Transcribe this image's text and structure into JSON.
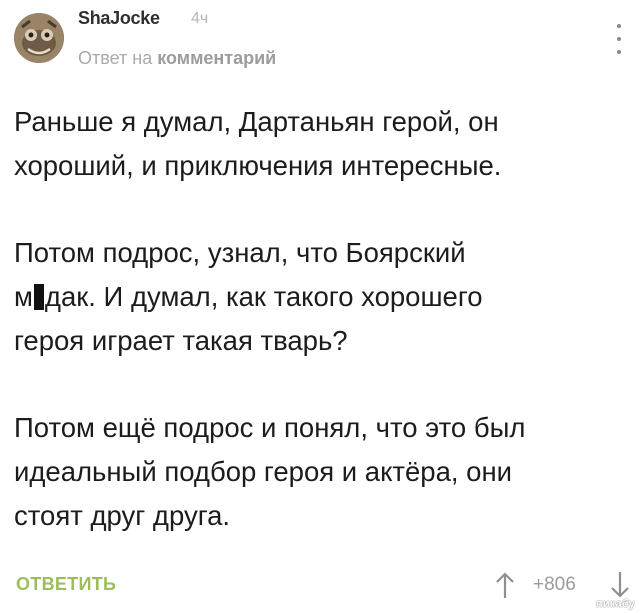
{
  "comment_header": {
    "username": "ShaJocke",
    "time": "4ч",
    "reply_prefix": "Ответ на",
    "reply_target": "комментарий",
    "avatar_icon": "user-avatar",
    "more_icon": "vertical-dots-icon"
  },
  "comment_body": {
    "paragraph_1": {
      "line_1": "Раньше я думал, Дартаньян герой, он",
      "line_2": "хороший, и приключения интересные."
    },
    "paragraph_2": {
      "line_1": "Потом подрос, узнал, что Боярский",
      "line_2_start": "м",
      "line_2_end": "дак. И думал, как такого хорошего",
      "line_3": "героя играет такая тварь?"
    },
    "paragraph_3": {
      "line_1": "Потом ещё подрос и понял, что это был",
      "line_2": "идеальный подбор героя и актёра, они",
      "line_3": "стоят друг друга."
    }
  },
  "comment_footer": {
    "reply_label": "ОТВЕТИТЬ",
    "rating": "+806",
    "upvote_icon": "arrow-up-icon",
    "downvote_icon": "arrow-down-icon"
  },
  "watermark": "пикабу",
  "colors": {
    "reply_green": "#9dbd5d",
    "muted_gray": "#a9a9a9",
    "text": "#1c1c1c"
  }
}
